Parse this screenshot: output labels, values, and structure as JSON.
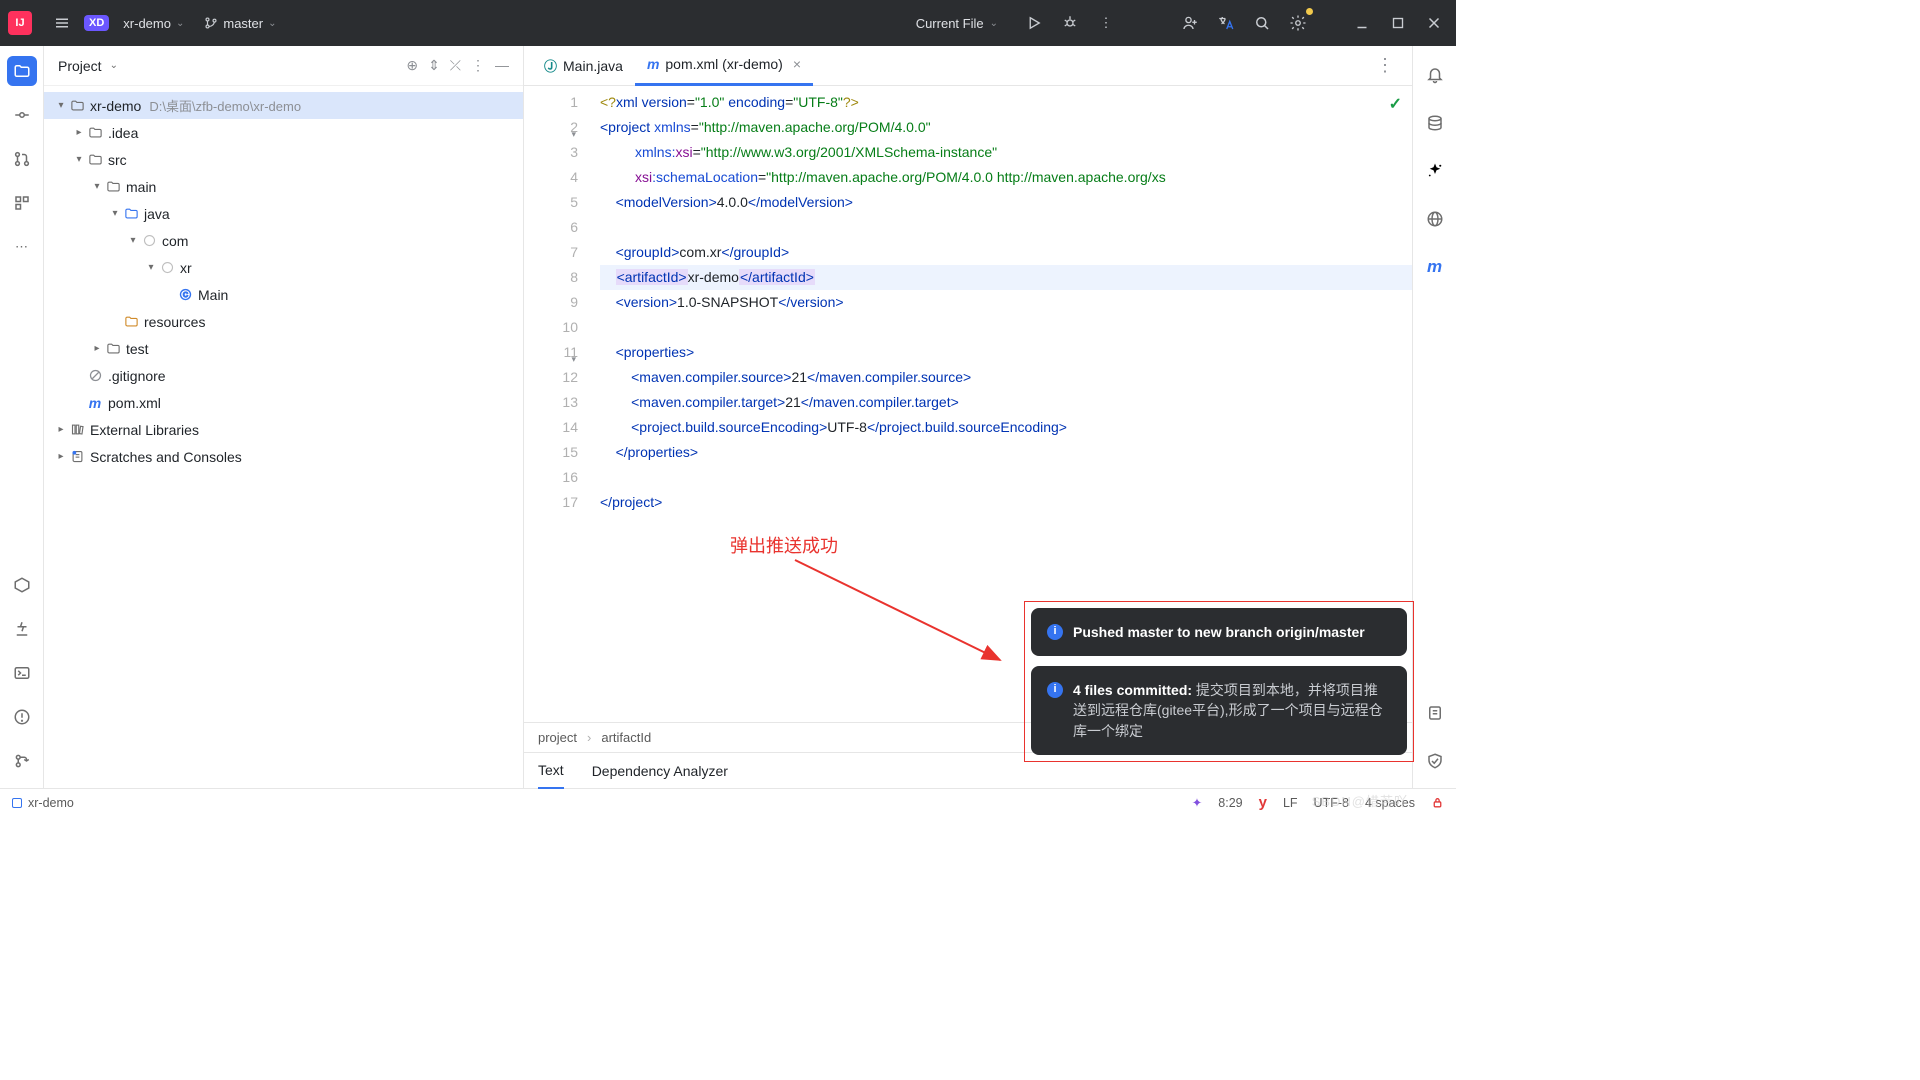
{
  "titlebar": {
    "project": "xr-demo",
    "branch": "master",
    "runConfig": "Current File"
  },
  "sidebar": {
    "title": "Project",
    "tree": [
      {
        "indent": 0,
        "tw": "▾",
        "icon": "folder-root",
        "label": "xr-demo",
        "path": "D:\\桌面\\zfb-demo\\xr-demo",
        "sel": true
      },
      {
        "indent": 1,
        "tw": "▸",
        "icon": "folder",
        "label": ".idea"
      },
      {
        "indent": 1,
        "tw": "▾",
        "icon": "folder",
        "label": "src"
      },
      {
        "indent": 2,
        "tw": "▾",
        "icon": "folder",
        "label": "main"
      },
      {
        "indent": 3,
        "tw": "▾",
        "icon": "folder-src",
        "label": "java"
      },
      {
        "indent": 4,
        "tw": "▾",
        "icon": "package",
        "label": "com"
      },
      {
        "indent": 5,
        "tw": "▾",
        "icon": "package",
        "label": "xr"
      },
      {
        "indent": 6,
        "tw": "",
        "icon": "class",
        "label": "Main"
      },
      {
        "indent": 3,
        "tw": "",
        "icon": "folder-res",
        "label": "resources"
      },
      {
        "indent": 2,
        "tw": "▸",
        "icon": "folder",
        "label": "test"
      },
      {
        "indent": 1,
        "tw": "",
        "icon": "gitignore",
        "label": ".gitignore"
      },
      {
        "indent": 1,
        "tw": "",
        "icon": "maven",
        "label": "pom.xml"
      },
      {
        "indent": 0,
        "tw": "▸",
        "icon": "lib",
        "label": "External Libraries"
      },
      {
        "indent": 0,
        "tw": "▸",
        "icon": "scratch",
        "label": "Scratches and Consoles"
      }
    ]
  },
  "tabs": [
    {
      "icon": "java",
      "label": "Main.java",
      "active": false,
      "closable": false
    },
    {
      "icon": "maven",
      "label": "pom.xml (xr-demo)",
      "active": true,
      "closable": true
    }
  ],
  "code": {
    "lines": [
      {
        "n": 1,
        "html": "<span class='t-pi'>&lt;?</span><span class='t-tag'>xml version</span><span class='t-txt'>=</span><span class='t-str'>\"1.0\"</span> <span class='t-tag'>encoding</span><span class='t-txt'>=</span><span class='t-str'>\"UTF-8\"</span><span class='t-pi'>?&gt;</span>"
      },
      {
        "n": 2,
        "fold": "▾",
        "html": "<span class='t-tag'>&lt;project</span> <span class='t-attr'>xmlns</span><span class='t-txt'>=</span><span class='t-str'>\"http://maven.apache.org/POM/4.0.0\"</span>"
      },
      {
        "n": 3,
        "html": "         <span class='t-attr'>xmlns:</span><span class='t-ns'>xsi</span><span class='t-txt'>=</span><span class='t-str'>\"http://www.w3.org/2001/XMLSchema-instance\"</span>"
      },
      {
        "n": 4,
        "html": "         <span class='t-ns'>xsi</span><span class='t-attr'>:schemaLocation</span><span class='t-txt'>=</span><span class='t-str'>\"http://maven.apache.org/POM/4.0.0 http://maven.apache.org/xs</span>"
      },
      {
        "n": 5,
        "html": "    <span class='t-tag'>&lt;modelVersion&gt;</span><span class='t-txt'>4.0.0</span><span class='t-tag'>&lt;/modelVersion&gt;</span>"
      },
      {
        "n": 6,
        "html": ""
      },
      {
        "n": 7,
        "html": "    <span class='t-tag'>&lt;groupId&gt;</span><span class='t-txt'>com.xr</span><span class='t-tag'>&lt;/groupId&gt;</span>"
      },
      {
        "n": 8,
        "hl": true,
        "html": "    <span class='hl-tag'><span class='t-tag'>&lt;artifactId&gt;</span></span><span class='t-txt'>xr-demo</span><span class='hl-tag'><span class='t-tag'>&lt;/artifactId&gt;</span></span>"
      },
      {
        "n": 9,
        "html": "    <span class='t-tag'>&lt;version&gt;</span><span class='t-txt'>1.0-SNAPSHOT</span><span class='t-tag'>&lt;/version&gt;</span>"
      },
      {
        "n": 10,
        "html": ""
      },
      {
        "n": 11,
        "fold": "▾",
        "html": "    <span class='t-tag'>&lt;properties&gt;</span>"
      },
      {
        "n": 12,
        "bar": true,
        "html": "        <span class='t-tag'>&lt;maven.compiler.source&gt;</span><span class='t-txt'>21</span><span class='t-tag'>&lt;/maven.compiler.source&gt;</span>"
      },
      {
        "n": 13,
        "bar": true,
        "html": "        <span class='t-tag'>&lt;maven.compiler.target&gt;</span><span class='t-txt'>21</span><span class='t-tag'>&lt;/maven.compiler.target&gt;</span>"
      },
      {
        "n": 14,
        "bar": true,
        "html": "        <span class='t-tag'>&lt;project.build.sourceEncoding&gt;</span><span class='t-txt'>UTF-8</span><span class='t-tag'>&lt;/project.build.sourceEncoding&gt;</span>"
      },
      {
        "n": 15,
        "html": "    <span class='t-tag'>&lt;/properties&gt;</span>"
      },
      {
        "n": 16,
        "html": ""
      },
      {
        "n": 17,
        "html": "<span class='t-tag'>&lt;/project&gt;</span>"
      }
    ]
  },
  "breadcrumb": [
    "project",
    "artifactId"
  ],
  "subtabs": [
    {
      "label": "Text",
      "active": true
    },
    {
      "label": "Dependency Analyzer",
      "active": false
    }
  ],
  "annotation": "弹出推送成功",
  "notifications": [
    {
      "title": "Pushed master to new branch origin/master"
    },
    {
      "title": "4 files committed: ",
      "body": "提交项目到本地，并将项目推送到远程仓库(gitee平台),形成了一个项目与远程仓库一个绑定"
    }
  ],
  "statusbar": {
    "project": "xr-demo",
    "pos": "8:29",
    "lf": "LF",
    "enc": "UTF-8",
    "indent": "4 spaces"
  },
  "watermark": "SBDN@惜若吖"
}
